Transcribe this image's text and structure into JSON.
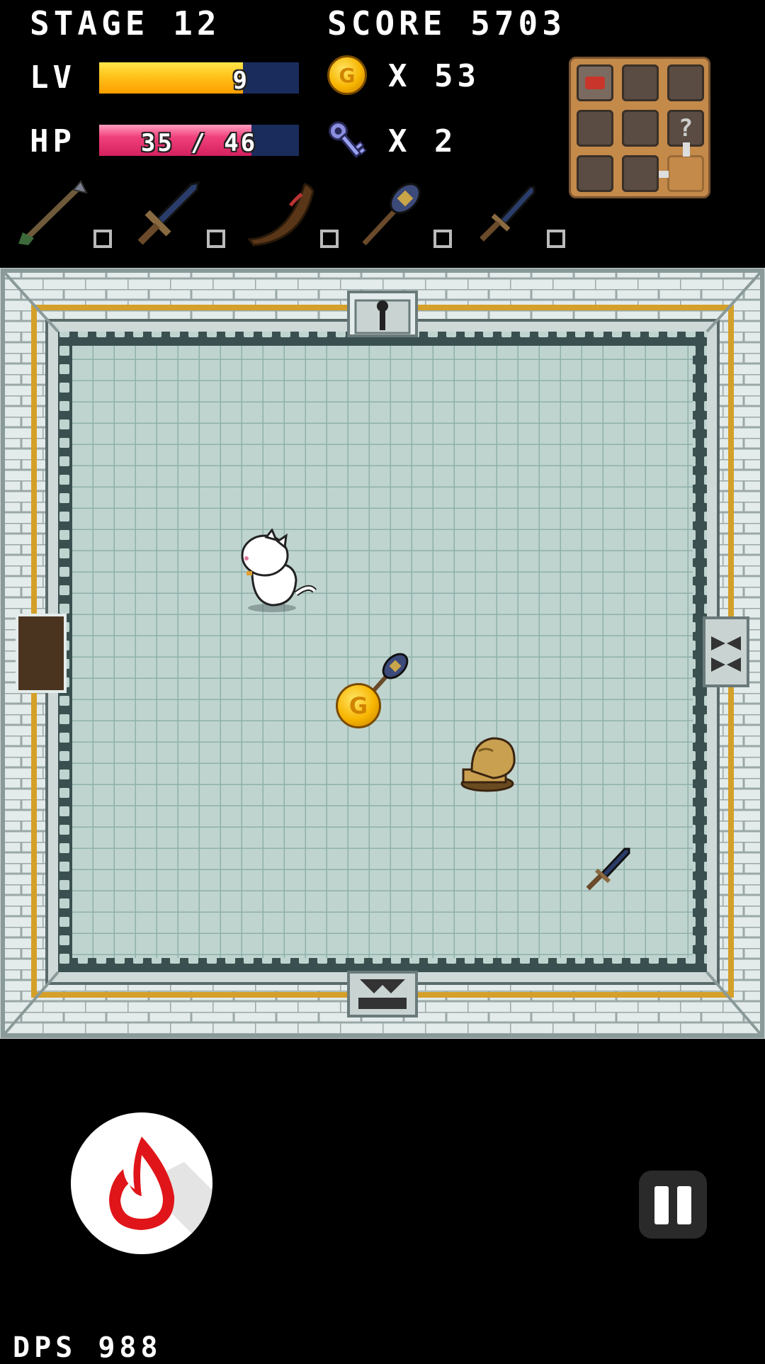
{
  "hud": {
    "stage_label": "STAGE 12",
    "score_label": "SCORE 5703",
    "lv_label": "LV",
    "lv_value": "9",
    "lv_progress": 0.72,
    "hp_label": "HP",
    "hp_text": "35 / 46",
    "hp_current": 35,
    "hp_max": 46,
    "coins_text": "X 53",
    "keys_text": "X 2",
    "dps_label": "DPS 988"
  },
  "weapons": [
    {
      "name": "arrow-icon"
    },
    {
      "name": "sword-icon"
    },
    {
      "name": "boomerang-icon"
    },
    {
      "name": "battle-axe-icon"
    },
    {
      "name": "dagger-icon"
    }
  ],
  "minimap": {
    "unknown_room_glyph": "?"
  },
  "room": {
    "coin_glyph": "G"
  },
  "colors": {
    "lv_fill": "#ffc21a",
    "hp_fill": "#f0407a",
    "bar_bg": "#1a2c5c",
    "fire_red": "#e0151a"
  }
}
